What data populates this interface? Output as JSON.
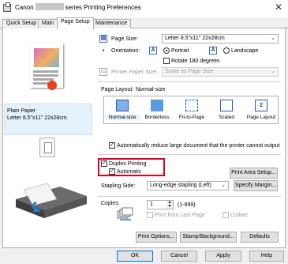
{
  "window": {
    "title_prefix": "Canon",
    "title_suffix": "series Printing Preferences",
    "close_glyph": "✕"
  },
  "tabs": [
    {
      "label": "Quick Setup"
    },
    {
      "label": "Main"
    },
    {
      "label": "Page Setup",
      "active": true
    },
    {
      "label": "Maintenance"
    }
  ],
  "paper_info": {
    "type": "Plain Paper",
    "size": "Letter 8.5\"x11\" 22x28cm"
  },
  "page_size": {
    "label": "Page Size:",
    "value": "Letter 8.5\"x11\" 22x28cm"
  },
  "orientation": {
    "label": "Orientation:",
    "portrait": "Portrait",
    "landscape": "Landscape",
    "selected": "Portrait",
    "portrait_icon": "A",
    "landscape_icon": "A",
    "rotate_label": "Rotate 180 degrees",
    "rotate_checked": false
  },
  "printer_paper_size": {
    "label": "Printer Paper Size:",
    "value": "Same as Page Size",
    "disabled": true
  },
  "page_layout": {
    "label": "Page Layout:",
    "current": "Normal-size",
    "options": [
      "Normal-size",
      "Borderless",
      "Fit-to-Page",
      "Scaled",
      "Page Layout"
    ],
    "selected_index": 0,
    "page_layout_icon_text": "2"
  },
  "auto_reduce": {
    "label": "Automatically reduce large document that the printer cannot output",
    "checked": true
  },
  "duplex": {
    "label": "Duplex Printing",
    "checked": true,
    "automatic_label": "Automatic",
    "automatic_checked": true
  },
  "buttons": {
    "print_area_setup": "Print Area Setup...",
    "specify_margin": "Specify Margin...",
    "print_options": "Print Options...",
    "stamp_background": "Stamp/Background...",
    "defaults": "Defaults",
    "ok": "OK",
    "cancel": "Cancel",
    "apply": "Apply",
    "help": "Help"
  },
  "stapling_side": {
    "label": "Stapling Side:",
    "value": "Long-edge stapling (Left)"
  },
  "copies": {
    "label": "Copies:",
    "value": "1",
    "range": "(1-999)",
    "print_from_last": "Print from Last Page",
    "print_from_last_checked": false,
    "collate": "Collate",
    "collate_checked": false
  },
  "colors": {
    "highlight_red": "#e0001a",
    "selection_blue": "#e5f1fb",
    "accent_blue": "#0078d7"
  }
}
